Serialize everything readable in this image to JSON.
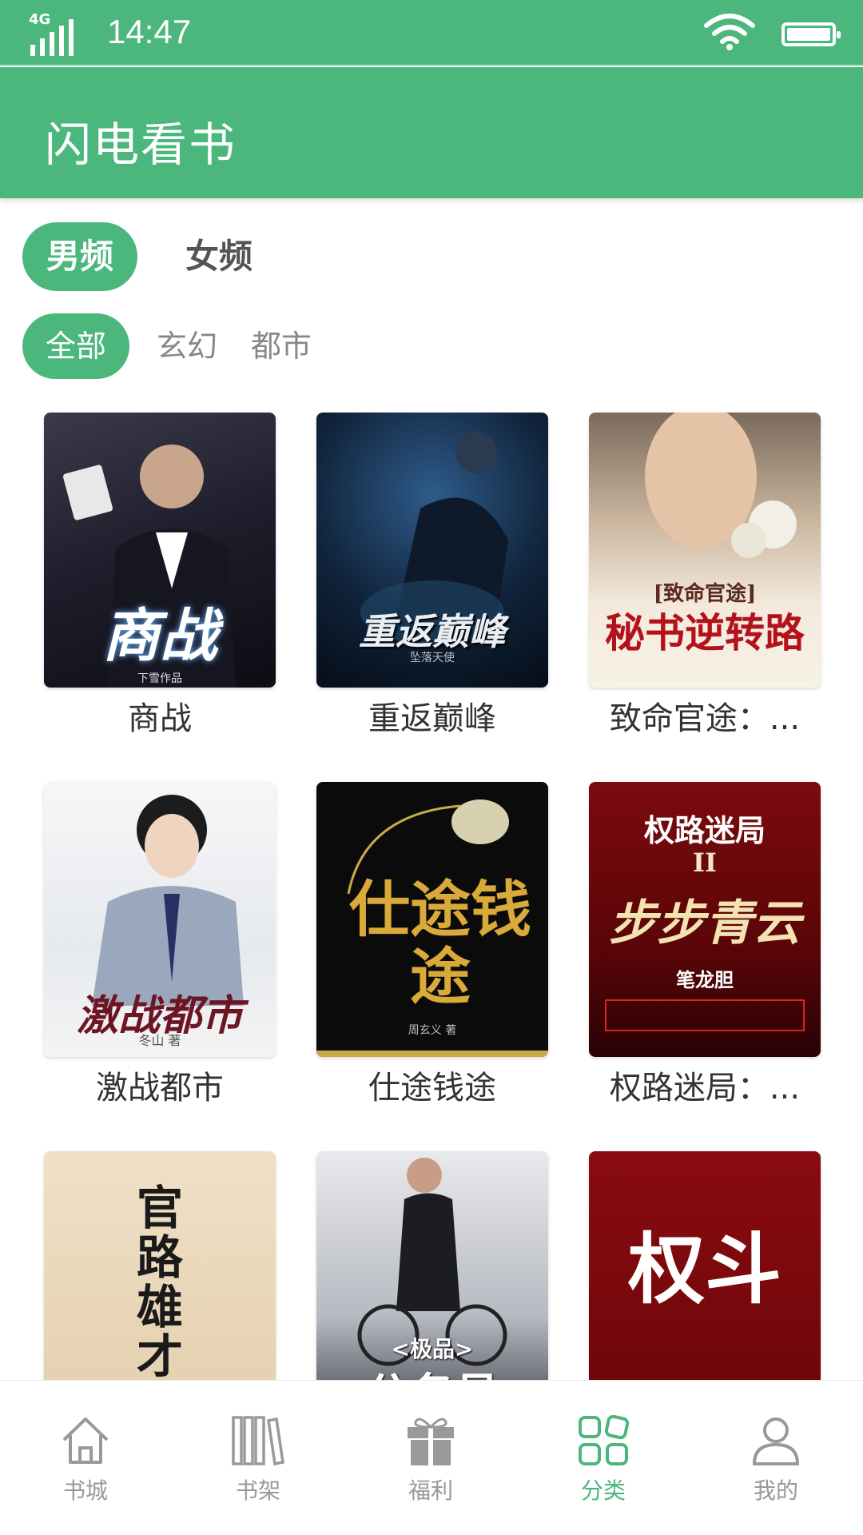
{
  "status_bar": {
    "network": "4G",
    "time": "14:47"
  },
  "app": {
    "title": "闪电看书"
  },
  "gender_tabs": [
    {
      "label": "男频",
      "active": true
    },
    {
      "label": "女频",
      "active": false
    }
  ],
  "category_tabs": [
    {
      "label": "全部",
      "active": true
    },
    {
      "label": "玄幻",
      "active": false
    },
    {
      "label": "都市",
      "active": false
    }
  ],
  "books": [
    {
      "name": "商战",
      "cover_text": "商战",
      "cover_author": "下雪作品"
    },
    {
      "name": "重返巅峰",
      "cover_text": "重返巅峰",
      "cover_author": "坠落天使"
    },
    {
      "name": "致命官途：...",
      "cover_top": "[致命官途]",
      "cover_text": "秘书逆转路"
    },
    {
      "name": "激战都市",
      "cover_text": "激战都市",
      "cover_author": "冬山 著"
    },
    {
      "name": "仕途钱途",
      "cover_text": "仕途钱途",
      "cover_author": "周玄义 著"
    },
    {
      "name": "权路迷局：...",
      "cover_top": "权路迷局",
      "cover_sub": "II",
      "cover_text": "步步青云",
      "cover_author": "笔龙胆"
    },
    {
      "name": "",
      "cover_text": "官路雄才"
    },
    {
      "name": "",
      "cover_top": "<极品>",
      "cover_text": "公务员"
    },
    {
      "name": "",
      "cover_text": "权斗"
    }
  ],
  "bottom_nav": [
    {
      "label": "书城",
      "icon": "home-icon",
      "active": false
    },
    {
      "label": "书架",
      "icon": "bookshelf-icon",
      "active": false
    },
    {
      "label": "福利",
      "icon": "gift-icon",
      "active": false
    },
    {
      "label": "分类",
      "icon": "category-icon",
      "active": true
    },
    {
      "label": "我的",
      "icon": "profile-icon",
      "active": false
    }
  ],
  "colors": {
    "primary": "#4bb77d",
    "text": "#333333",
    "muted": "#999999"
  }
}
